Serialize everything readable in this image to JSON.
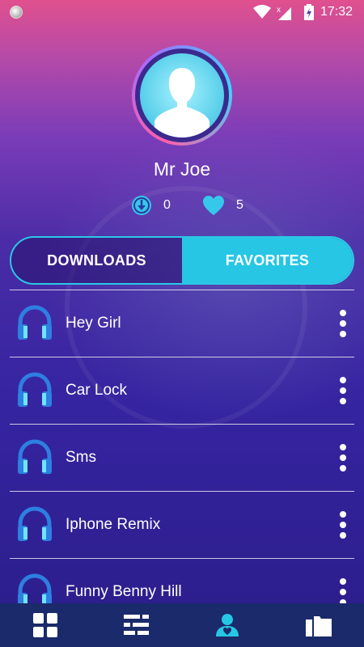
{
  "status_bar": {
    "time": "17:32"
  },
  "profile": {
    "name": "Mr Joe"
  },
  "stats": {
    "downloads_count": "0",
    "favorites_count": "5"
  },
  "tabs": [
    {
      "label": "DOWNLOADS",
      "active": false
    },
    {
      "label": "FAVORITES",
      "active": true
    }
  ],
  "songs": [
    {
      "title": "Hey Girl"
    },
    {
      "title": "Car Lock"
    },
    {
      "title": "Sms"
    },
    {
      "title": "Iphone Remix"
    },
    {
      "title": "Funny Benny Hill"
    }
  ],
  "bottom_nav": [
    {
      "icon": "grid-icon",
      "active": false
    },
    {
      "icon": "equalizer-icon",
      "active": false
    },
    {
      "icon": "profile-icon",
      "active": true
    },
    {
      "icon": "folder-icon",
      "active": false
    }
  ],
  "colors": {
    "accent": "#26c6e4",
    "nav_bg": "#1a2a6a",
    "active_nav": "#26c6e4"
  }
}
